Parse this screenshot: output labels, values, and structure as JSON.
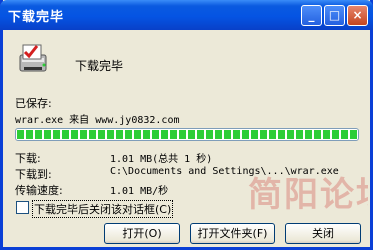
{
  "window": {
    "title": "下载完毕",
    "minimize_icon": "minimize-icon",
    "maximize_icon": "maximize-icon",
    "close_icon": "close-icon"
  },
  "header": {
    "text": "下载完毕",
    "icon": "download-complete-icon"
  },
  "saved": {
    "label": "已保存:",
    "value": "wrar.exe 来自 www.jy0832.com"
  },
  "progress": {
    "percent": 100,
    "color": "#2ccd36"
  },
  "info": [
    {
      "label": "下载:",
      "value": "1.01 MB(总共 1 秒)"
    },
    {
      "label": "下载到:",
      "value": "C:\\Documents and Settings\\...\\wrar.exe"
    },
    {
      "label": "传输速度:",
      "value": "1.01 MB/秒"
    }
  ],
  "checkbox": {
    "label": "下载完毕后关闭该对话框(C)",
    "checked": false
  },
  "buttons": {
    "open": "打开(O)",
    "open_folder": "打开文件夹(F)",
    "close": "关闭"
  },
  "watermark": "简阳论坛"
}
